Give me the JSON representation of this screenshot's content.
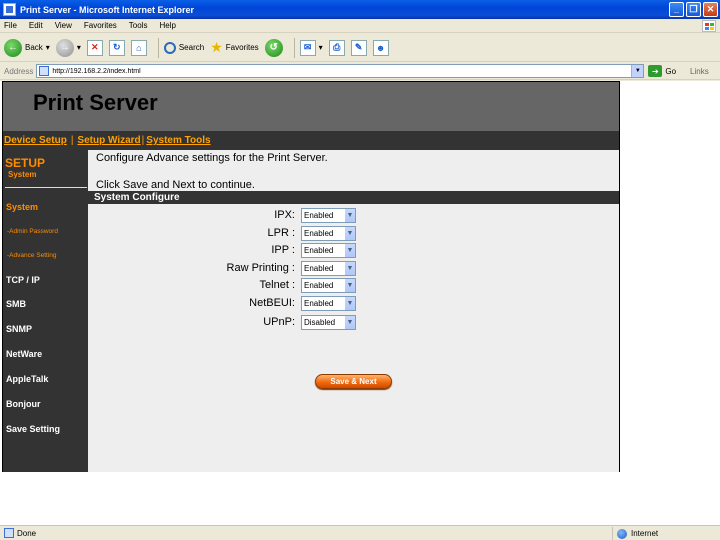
{
  "window": {
    "title": "Print Server - Microsoft Internet Explorer",
    "minimize": "_",
    "maximize": "❐",
    "close": "✕"
  },
  "menu": [
    "File",
    "Edit",
    "View",
    "Favorites",
    "Tools",
    "Help"
  ],
  "toolbar": {
    "back_label": "Back",
    "search_label": "Search",
    "favorites_label": "Favorites"
  },
  "address": {
    "label": "Address",
    "url": "http://192.168.2.2/index.html",
    "go_label": "Go",
    "links_label": "Links"
  },
  "page": {
    "title": "Print Server",
    "nav": [
      "Device Setup",
      "Setup Wizard",
      "System Tools"
    ],
    "sidebar": {
      "heading": "SETUP",
      "subheading": "System",
      "items": [
        "System",
        "TCP / IP",
        "SMB",
        "SNMP",
        "NetWare",
        "AppleTalk",
        "Bonjour",
        "Save Setting"
      ],
      "subitems": [
        "-Admin Password",
        "-Advance Setting"
      ]
    },
    "description": "Configure Advance settings for the Print Server.",
    "instruction": "Click Save and Next to continue.",
    "section_title": "System Configure",
    "fields": [
      {
        "label": "IPX:",
        "value": "Enabled"
      },
      {
        "label": "LPR :",
        "value": "Enabled"
      },
      {
        "label": "IPP :",
        "value": "Enabled"
      },
      {
        "label": "Raw Printing :",
        "value": "Enabled"
      },
      {
        "label": "Telnet :",
        "value": "Enabled"
      },
      {
        "label": "NetBEUI:",
        "value": "Enabled"
      },
      {
        "label": "UPnP:",
        "value": "Disabled"
      }
    ],
    "save_button": "Save & Next"
  },
  "status": {
    "text": "Done",
    "zone": "Internet"
  },
  "colors": {
    "accent_orange": "#FF8C00",
    "nav_link": "#FFA300",
    "header_gray": "#666666",
    "dark_bar": "#333333"
  }
}
